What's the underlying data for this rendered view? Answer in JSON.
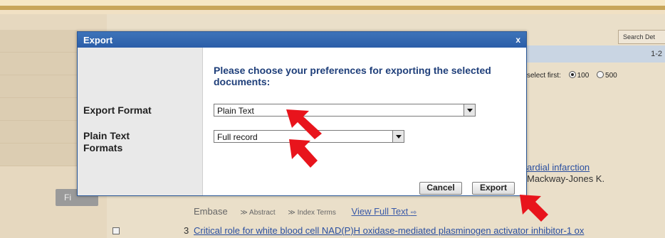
{
  "background": {
    "search_button": "Search Det",
    "page_info": "1-2",
    "select_first_label": "select first:",
    "select_options": [
      "100",
      "500"
    ],
    "selected_option": "100",
    "result2_title": "ardial infarction",
    "result2_authors": "Mackway-Jones K.",
    "meta_source": "Embase",
    "meta_abstract": "Abstract",
    "meta_index_terms": "Index Terms",
    "meta_full_text": "View Full Text",
    "result3_number": "3",
    "result3_title": "Critical role for white blood cell NAD(P)H oxidase-mediated plasminogen activator inhibitor-1 ox",
    "left_button": "Fi"
  },
  "dialog": {
    "title": "Export",
    "close_label": "x",
    "prompt": "Please choose your preferences for exporting the selected documents:",
    "export_format_label": "Export Format",
    "export_format_value": "Plain Text",
    "plain_text_formats_label": "Plain Text Formats",
    "plain_text_formats_value": "Full record",
    "cancel_label": "Cancel",
    "export_label": "Export"
  },
  "colors": {
    "dialog_title_bg": "#2b5ea8",
    "prompt_text": "#1f3f7a",
    "annotation_arrow": "#e8141c"
  }
}
